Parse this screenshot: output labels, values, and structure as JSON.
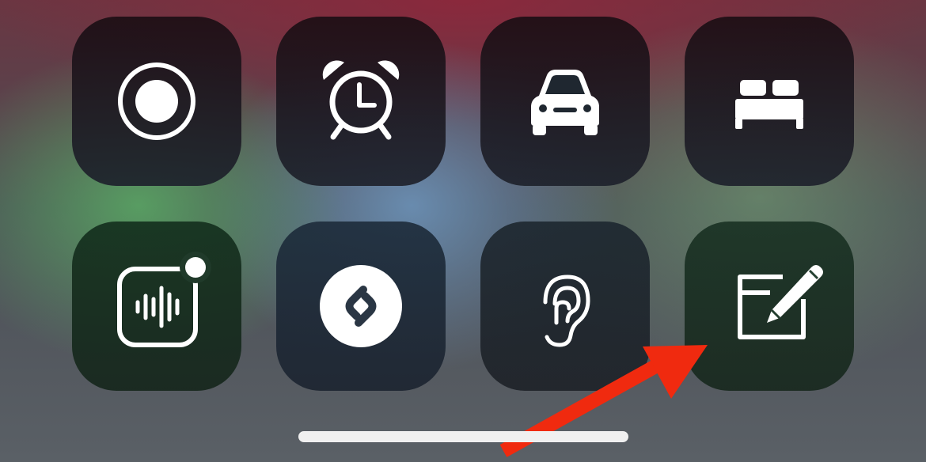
{
  "controls": [
    {
      "id": "screen-recording",
      "icon": "screen-recording-icon"
    },
    {
      "id": "alarm",
      "icon": "alarm-clock-icon"
    },
    {
      "id": "driving-focus",
      "icon": "car-icon"
    },
    {
      "id": "sleep-focus",
      "icon": "bed-icon"
    },
    {
      "id": "voice-memos",
      "icon": "voice-memo-waveform-icon"
    },
    {
      "id": "shazam",
      "icon": "shazam-icon"
    },
    {
      "id": "hearing",
      "icon": "ear-icon"
    },
    {
      "id": "quick-note",
      "icon": "quick-note-icon"
    }
  ],
  "annotation": {
    "icon": "red-arrow-icon",
    "color": "#f02a0f",
    "target": "quick-note"
  },
  "colors": {
    "glyph": "#ffffff",
    "arrow": "#f02a0f"
  }
}
